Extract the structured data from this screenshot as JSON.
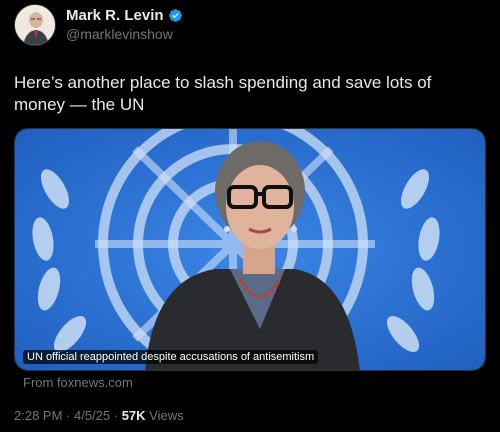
{
  "author": {
    "display_name": "Mark R. Levin",
    "handle": "@marklevinshow",
    "verified_icon": "verified-badge-icon",
    "verified_color": "#1d9bf0"
  },
  "tweet": {
    "text": "Here’s another place to slash spending and save lots of money — the UN"
  },
  "card": {
    "image_caption": "UN official reappointed despite accusations of antisemitism",
    "source": "From foxnews.com"
  },
  "meta": {
    "time": "2:28 PM",
    "separator1": " · ",
    "date": "4/5/25",
    "separator2": " · ",
    "views_count": "57K",
    "views_label": " Views"
  },
  "colors": {
    "background": "#000000",
    "text": "#e7e9ea",
    "muted": "#71767b",
    "un_blue": "#2a6fd1"
  }
}
